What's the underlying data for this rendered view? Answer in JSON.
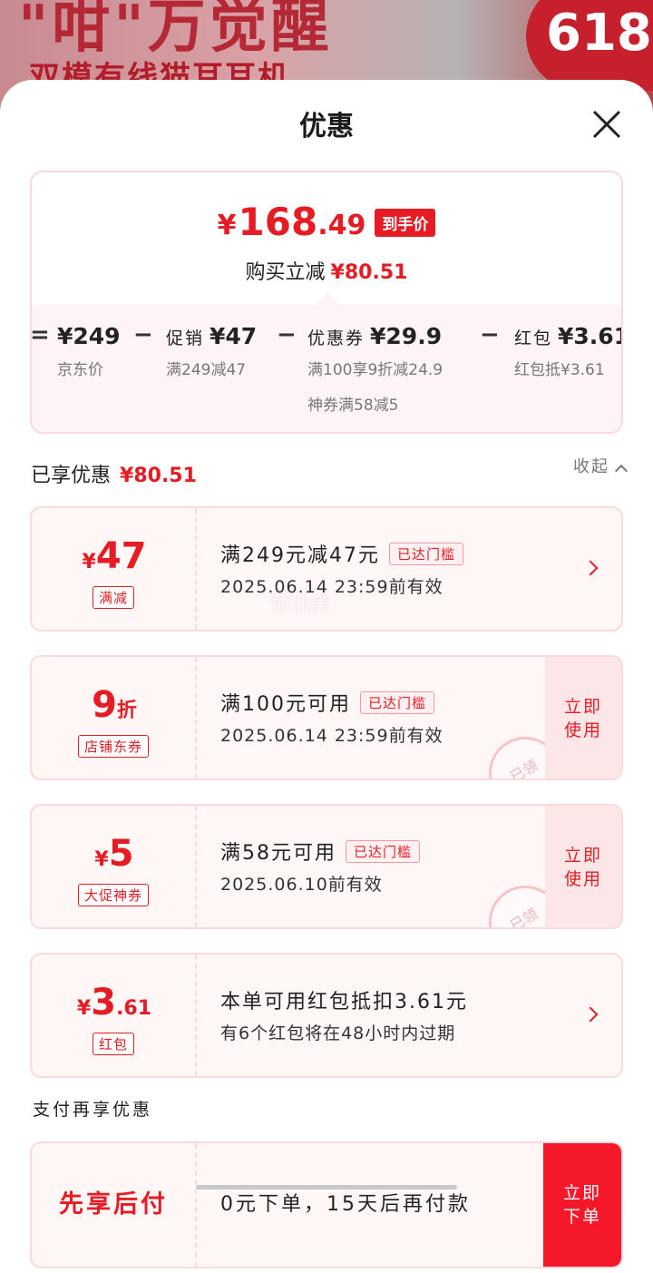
{
  "banner": {
    "title_partial": "\"咁\"万觉醒",
    "subtitle_partial": "双模有线猫耳耳机",
    "badge": "618"
  },
  "sheet": {
    "title": "优惠"
  },
  "summary": {
    "price_yen": "¥",
    "price_int": "168",
    "price_dec": ".49",
    "price_badge": "到手价",
    "reduce_label": "购买立减",
    "reduce_amount": "¥80.51",
    "breakdown": [
      {
        "op": "=",
        "label": "",
        "value": "¥249",
        "desc": [
          "京东价"
        ]
      },
      {
        "op": "−",
        "label": "促销",
        "value": "¥47",
        "desc": [
          "满249减47"
        ]
      },
      {
        "op": "−",
        "label": "优惠券",
        "value": "¥29.9",
        "desc": [
          "满100享9折减24.9",
          "神券满58减5"
        ]
      },
      {
        "op": "−",
        "label": "红包",
        "value": "¥3.61",
        "desc": [
          "红包抵¥3.61"
        ]
      }
    ]
  },
  "enjoyed": {
    "label": "已享优惠",
    "amount": "¥80.51",
    "collapse_label": "收起"
  },
  "coupons": [
    {
      "yen": "¥",
      "num": "47",
      "suffix": "",
      "tag": "满减",
      "line1": "满249元减47元",
      "badge": "已达门槛",
      "line2": "2025.06.14 23:59前有效",
      "action": "chevron"
    },
    {
      "yen": "",
      "num": "9",
      "suffix": "折",
      "tag": "店铺东券",
      "line1": "满100元可用",
      "badge": "已达门槛",
      "line2": "2025.06.14 23:59前有效",
      "action": "use",
      "use_label_1": "立即",
      "use_label_2": "使用",
      "stamp": "已领"
    },
    {
      "yen": "¥",
      "num": "5",
      "suffix": "",
      "tag": "大促神券",
      "line1": "满58元可用",
      "badge": "已达门槛",
      "line2": "2025.06.10前有效",
      "action": "use",
      "use_label_1": "立即",
      "use_label_2": "使用",
      "stamp": "已领"
    },
    {
      "yen": "¥",
      "num": "3",
      "suffix": ".61",
      "tag": "红包",
      "line1": "本单可用红包抵扣3.61元",
      "badge": "",
      "line2": "有6个红包将在48小时内过期",
      "action": "chevron"
    }
  ],
  "watermark": "葡仙美",
  "payment": {
    "section_title": "支付再享优惠",
    "left": "先享后付",
    "main": "0元下单，15天后再付款",
    "btn_1": "立即",
    "btn_2": "下单"
  },
  "colors": {
    "accent": "#e51c23",
    "card_bg": "#fff6f6",
    "card_border": "#fadadd",
    "pay_button": "#f5182a"
  }
}
